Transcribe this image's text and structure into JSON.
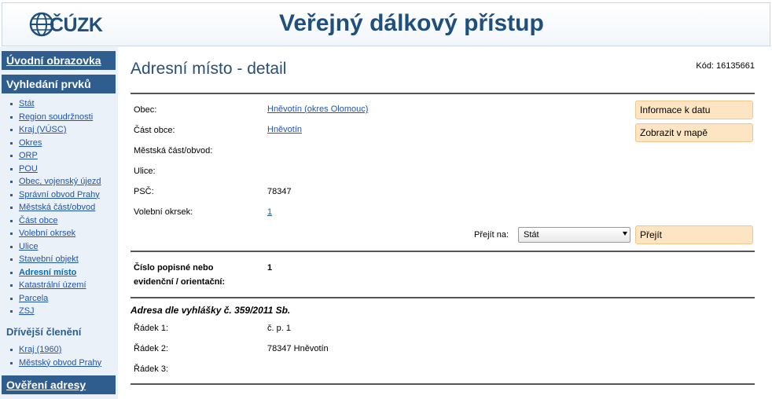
{
  "header": {
    "logo_text": "ÚZK",
    "logo_text_display": "ČÚZK",
    "title": "Veřejný dálkový přístup"
  },
  "sidebar": {
    "home": "Úvodní obrazovka",
    "search": "Vyhledání prvků",
    "items": [
      {
        "label": "Stát"
      },
      {
        "label": "Region soudržnosti"
      },
      {
        "label": "Kraj (VÚSC)"
      },
      {
        "label": "Okres"
      },
      {
        "label": "ORP"
      },
      {
        "label": "POU"
      },
      {
        "label": "Obec, vojenský újezd"
      },
      {
        "label": "Správní obvod Prahy"
      },
      {
        "label": "Městská část/obvod"
      },
      {
        "label": "Část obce"
      },
      {
        "label": "Volební okrsek"
      },
      {
        "label": "Ulice"
      },
      {
        "label": "Stavební objekt"
      },
      {
        "label": "Adresní místo"
      },
      {
        "label": "Katastrální území"
      },
      {
        "label": "Parcela"
      },
      {
        "label": "ZSJ"
      }
    ],
    "former_heading": "Dřívější členění",
    "former_items": [
      {
        "label": "Kraj (1960)"
      },
      {
        "label": "Městský obvod Prahy"
      }
    ],
    "verify": "Ověření adresy"
  },
  "main": {
    "title": "Adresní místo - detail",
    "code": "Kód: 16135661",
    "fields": {
      "obec_label": "Obec:",
      "obec_value": "Hněvotín (okres Olomouc)",
      "cast_label": "Část obce:",
      "cast_value": "Hněvotín",
      "mestska_label": "Městská část/obvod:",
      "ulice_label": "Ulice:",
      "psc_label": "PSČ:",
      "psc_value": "78347",
      "okrsek_label": "Volební okrsek:",
      "okrsek_value": "1"
    },
    "buttons": {
      "info": "Informace k datu",
      "map": "Zobrazit v mapě",
      "go": "Přejít"
    },
    "goto": {
      "label": "Přejít na:",
      "selected": "Stát"
    },
    "number": {
      "label_line1": "Číslo popisné nebo",
      "label_line2": "evidenční / orientační:",
      "value": "1"
    },
    "address": {
      "heading": "Adresa dle vyhlášky č. 359/2011 Sb.",
      "line1_label": "Řádek 1:",
      "line1_value": "č. p. 1",
      "line2_label": "Řádek 2:",
      "line2_value": "78347 Hněvotín",
      "line3_label": "Řádek 3:"
    }
  },
  "colors": {
    "brand": "#1f4f7d",
    "nav_head": "#2f5e8e",
    "sidebar_bg": "#eaf1f8",
    "button_bg": "#fde5c3",
    "link": "#2255aa"
  }
}
